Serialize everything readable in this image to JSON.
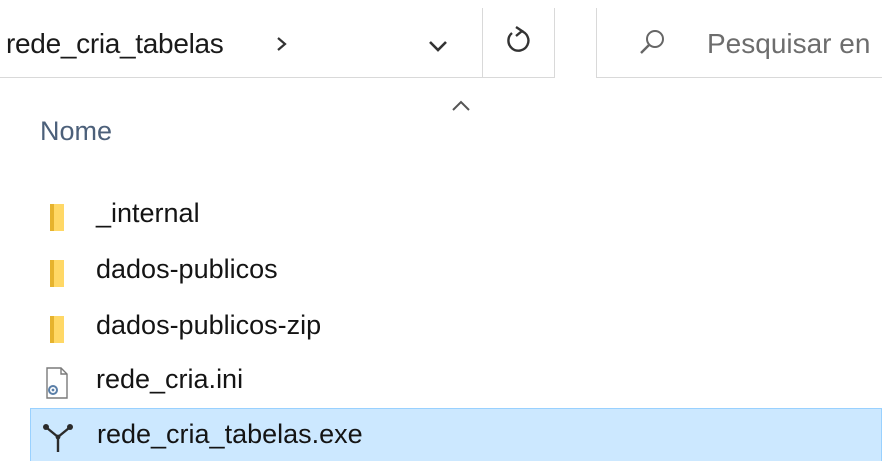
{
  "address_bar": {
    "breadcrumb": "rede_cria_tabelas",
    "chevron_icon": "chevron-right-icon",
    "dropdown_icon": "chevron-down-icon",
    "refresh_icon": "refresh-icon"
  },
  "search": {
    "placeholder": "Pesquisar en",
    "icon": "search-icon"
  },
  "column_header": {
    "name_label": "Nome",
    "sort_indicator": "sort-ascending-icon"
  },
  "files": [
    {
      "name": "_internal",
      "type": "folder",
      "icon": "folder-icon"
    },
    {
      "name": "dados-publicos",
      "type": "folder",
      "icon": "folder-icon"
    },
    {
      "name": "dados-publicos-zip",
      "type": "folder",
      "icon": "folder-icon"
    },
    {
      "name": "rede_cria.ini",
      "type": "settings-file",
      "icon": "config-file-icon"
    },
    {
      "name": "rede_cria_tabelas.exe",
      "type": "executable",
      "icon": "app-executable-icon",
      "selected": true
    }
  ],
  "colors": {
    "folder": "#ffd866",
    "folder_dark": "#e6b32e",
    "selection_bg": "#cce8ff",
    "selection_border": "#99d1ff",
    "header_text": "#4c607a"
  }
}
